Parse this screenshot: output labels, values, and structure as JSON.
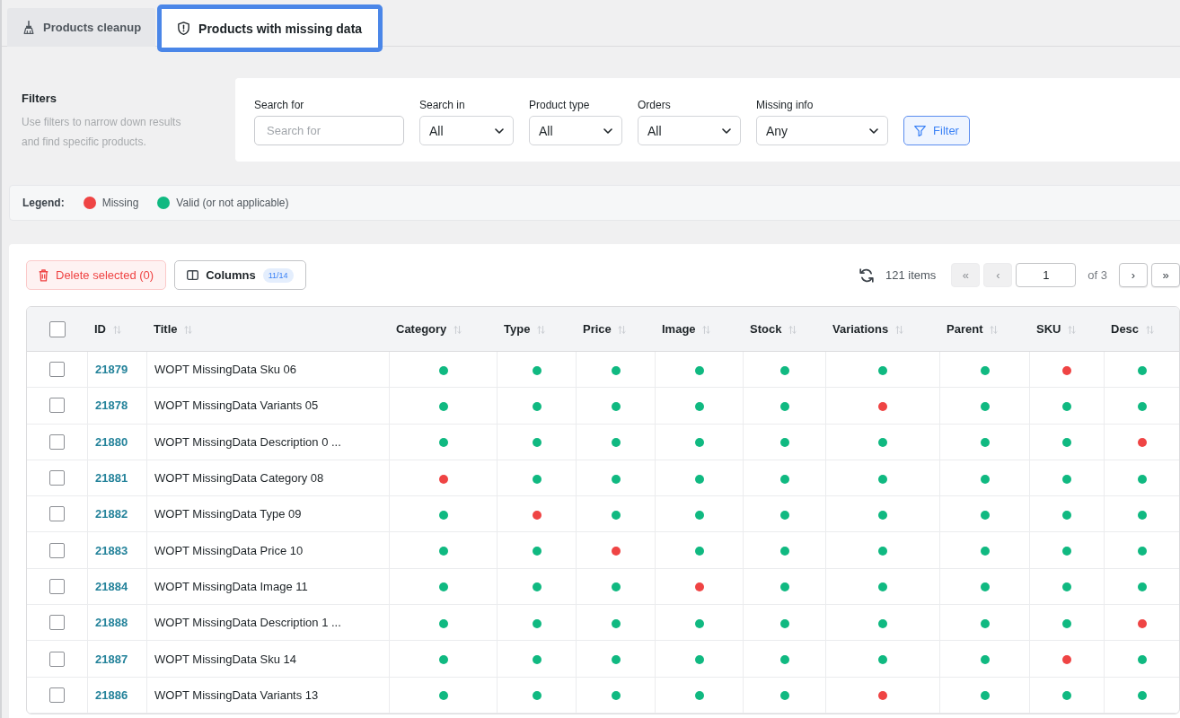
{
  "tabs": [
    {
      "label": "Products cleanup",
      "selected": false
    },
    {
      "label": "Products with missing data",
      "selected": true
    }
  ],
  "filters": {
    "title": "Filters",
    "description": "Use filters to narrow down results and find specific products.",
    "fields": [
      {
        "kind": "text",
        "label": "Search for",
        "placeholder": "Search for"
      },
      {
        "kind": "select",
        "label": "Search in",
        "value": "All"
      },
      {
        "kind": "select",
        "label": "Product type",
        "value": "All"
      },
      {
        "kind": "select",
        "label": "Orders",
        "value": "All"
      },
      {
        "kind": "select",
        "label": "Missing info",
        "value": "Any"
      }
    ],
    "filter_button": "Filter"
  },
  "legend": {
    "label": "Legend:",
    "items": [
      {
        "label": "Missing",
        "color": "#ef4444"
      },
      {
        "label": "Valid (or not applicable)",
        "color": "#10b981"
      }
    ]
  },
  "toolbar": {
    "delete_button": "Delete selected (0)",
    "columns_button": {
      "label": "Columns",
      "badge": "11/14"
    },
    "item_count": "121 items",
    "pagination": {
      "first": {
        "label": "«",
        "disabled": true
      },
      "previous": {
        "label": "‹",
        "disabled": true
      },
      "page": "1",
      "total": "of 3",
      "next": {
        "label": "›",
        "disabled": false
      },
      "last": {
        "label": "»",
        "disabled": false
      }
    }
  },
  "table": {
    "select_all_checked": false,
    "columns": [
      {
        "label": "ID",
        "kind": "id"
      },
      {
        "label": "Title",
        "kind": "title"
      },
      {
        "label": "Category",
        "kind": "status"
      },
      {
        "label": "Type",
        "kind": "status"
      },
      {
        "label": "Price",
        "kind": "status"
      },
      {
        "label": "Image",
        "kind": "status"
      },
      {
        "label": "Stock",
        "kind": "status"
      },
      {
        "label": "Variations",
        "kind": "status"
      },
      {
        "label": "Parent",
        "kind": "status"
      },
      {
        "label": "SKU",
        "kind": "status"
      },
      {
        "label": "Desc",
        "kind": "status"
      }
    ],
    "rows": [
      {
        "checked": false,
        "id": "21879",
        "title": "WOPT MissingData Sku 06",
        "checks": [
          {
            "missing": false
          },
          {
            "missing": false
          },
          {
            "missing": false
          },
          {
            "missing": false
          },
          {
            "missing": false
          },
          {
            "missing": false
          },
          {
            "missing": false
          },
          {
            "missing": true
          },
          {
            "missing": false
          }
        ]
      },
      {
        "checked": false,
        "id": "21878",
        "title": "WOPT MissingData Variants 05",
        "checks": [
          {
            "missing": false
          },
          {
            "missing": false
          },
          {
            "missing": false
          },
          {
            "missing": false
          },
          {
            "missing": false
          },
          {
            "missing": true
          },
          {
            "missing": false
          },
          {
            "missing": false
          },
          {
            "missing": false
          }
        ]
      },
      {
        "checked": false,
        "id": "21880",
        "title": "WOPT MissingData Description 0 ...",
        "checks": [
          {
            "missing": false
          },
          {
            "missing": false
          },
          {
            "missing": false
          },
          {
            "missing": false
          },
          {
            "missing": false
          },
          {
            "missing": false
          },
          {
            "missing": false
          },
          {
            "missing": false
          },
          {
            "missing": true
          }
        ]
      },
      {
        "checked": false,
        "id": "21881",
        "title": "WOPT MissingData Category 08",
        "checks": [
          {
            "missing": true
          },
          {
            "missing": false
          },
          {
            "missing": false
          },
          {
            "missing": false
          },
          {
            "missing": false
          },
          {
            "missing": false
          },
          {
            "missing": false
          },
          {
            "missing": false
          },
          {
            "missing": false
          }
        ]
      },
      {
        "checked": false,
        "id": "21882",
        "title": "WOPT MissingData Type 09",
        "checks": [
          {
            "missing": false
          },
          {
            "missing": true
          },
          {
            "missing": false
          },
          {
            "missing": false
          },
          {
            "missing": false
          },
          {
            "missing": false
          },
          {
            "missing": false
          },
          {
            "missing": false
          },
          {
            "missing": false
          }
        ]
      },
      {
        "checked": false,
        "id": "21883",
        "title": "WOPT MissingData Price 10",
        "checks": [
          {
            "missing": false
          },
          {
            "missing": false
          },
          {
            "missing": true
          },
          {
            "missing": false
          },
          {
            "missing": false
          },
          {
            "missing": false
          },
          {
            "missing": false
          },
          {
            "missing": false
          },
          {
            "missing": false
          }
        ]
      },
      {
        "checked": false,
        "id": "21884",
        "title": "WOPT MissingData Image 11",
        "checks": [
          {
            "missing": false
          },
          {
            "missing": false
          },
          {
            "missing": false
          },
          {
            "missing": true
          },
          {
            "missing": false
          },
          {
            "missing": false
          },
          {
            "missing": false
          },
          {
            "missing": false
          },
          {
            "missing": false
          }
        ]
      },
      {
        "checked": false,
        "id": "21888",
        "title": "WOPT MissingData Description 1 ...",
        "checks": [
          {
            "missing": false
          },
          {
            "missing": false
          },
          {
            "missing": false
          },
          {
            "missing": false
          },
          {
            "missing": false
          },
          {
            "missing": false
          },
          {
            "missing": false
          },
          {
            "missing": false
          },
          {
            "missing": true
          }
        ]
      },
      {
        "checked": false,
        "id": "21887",
        "title": "WOPT MissingData Sku 14",
        "checks": [
          {
            "missing": false
          },
          {
            "missing": false
          },
          {
            "missing": false
          },
          {
            "missing": false
          },
          {
            "missing": false
          },
          {
            "missing": false
          },
          {
            "missing": false
          },
          {
            "missing": true
          },
          {
            "missing": false
          }
        ]
      },
      {
        "checked": false,
        "id": "21886",
        "title": "WOPT MissingData Variants 13",
        "checks": [
          {
            "missing": false
          },
          {
            "missing": false
          },
          {
            "missing": false
          },
          {
            "missing": false
          },
          {
            "missing": false
          },
          {
            "missing": true
          },
          {
            "missing": false
          },
          {
            "missing": false
          },
          {
            "missing": false
          }
        ]
      }
    ]
  }
}
